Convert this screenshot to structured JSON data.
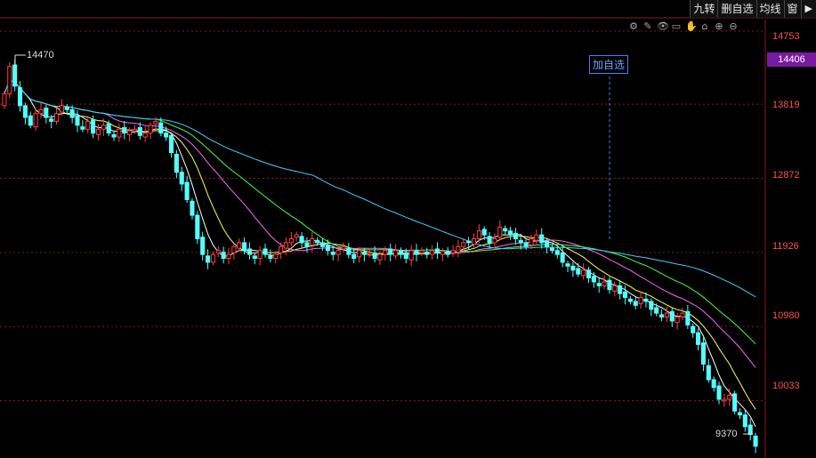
{
  "toolbar": {
    "buttons": [
      "九转",
      "删自选",
      "均线",
      "窗",
      "▶"
    ]
  },
  "tools": [
    "gear-icon",
    "pen-icon",
    "eye-icon",
    "briefcase-icon",
    "hand-icon",
    "lock-icon",
    "zoom-in-icon",
    "zoom-out-icon"
  ],
  "tool_glyphs": [
    "⚙",
    "✎",
    "👁",
    "▭",
    "✋",
    "⌂",
    "⊕",
    "⊖"
  ],
  "add_watch_label": "加自选",
  "current_price": "14406",
  "high_label": "14470",
  "low_label": "9370",
  "colors": {
    "up": "#ff4040",
    "down": "#54ffff",
    "grid": "#8a1a1a",
    "ma5": "#ffffff",
    "ma10": "#ffff55",
    "ma20": "#ff66ff",
    "ma30": "#44ff44",
    "ma60": "#44ccff"
  },
  "chart_data": {
    "type": "candlestick",
    "y_axis_ticks": [
      "14753",
      "13819",
      "12872",
      "11926",
      "10980",
      "10033"
    ],
    "ylim": [
      9300,
      14900
    ],
    "grid": true,
    "close": [
      13950,
      14300,
      14050,
      13800,
      13650,
      13550,
      13700,
      13750,
      13650,
      13600,
      13700,
      13800,
      13750,
      13650,
      13550,
      13500,
      13600,
      13450,
      13500,
      13550,
      13450,
      13400,
      13500,
      13450,
      13480,
      13500,
      13420,
      13450,
      13550,
      13600,
      13450,
      13400,
      13200,
      12950,
      12800,
      12600,
      12400,
      12100,
      11900,
      11800,
      11900,
      11950,
      11850,
      11900,
      12000,
      12050,
      11950,
      11900,
      11850,
      11950,
      11900,
      11850,
      11900,
      12000,
      12050,
      12100,
      12150,
      12050,
      12000,
      12100,
      12050,
      12000,
      11950,
      11900,
      11950,
      12000,
      11900,
      11850,
      11950,
      11900,
      11900,
      11850,
      11900,
      11950,
      11900,
      11950,
      11900,
      11850,
      11950,
      11900,
      11950,
      11900,
      11950,
      11920,
      11940,
      11900,
      11950,
      12000,
      12050,
      12050,
      12100,
      12200,
      12150,
      12050,
      12100,
      12250,
      12200,
      12150,
      12100,
      12050,
      12000,
      12100,
      12150,
      12050,
      12000,
      11950,
      11900,
      11800,
      11750,
      11700,
      11650,
      11700,
      11600,
      11550,
      11500,
      11550,
      11450,
      11500,
      11400,
      11350,
      11300,
      11250,
      11350,
      11300,
      11200,
      11150,
      11100,
      11150,
      11050,
      11100,
      11150,
      11000,
      10900,
      10750,
      10500,
      10300,
      10200,
      10050,
      10050,
      10100,
      9900,
      9850,
      9700,
      9600,
      9450
    ]
  }
}
